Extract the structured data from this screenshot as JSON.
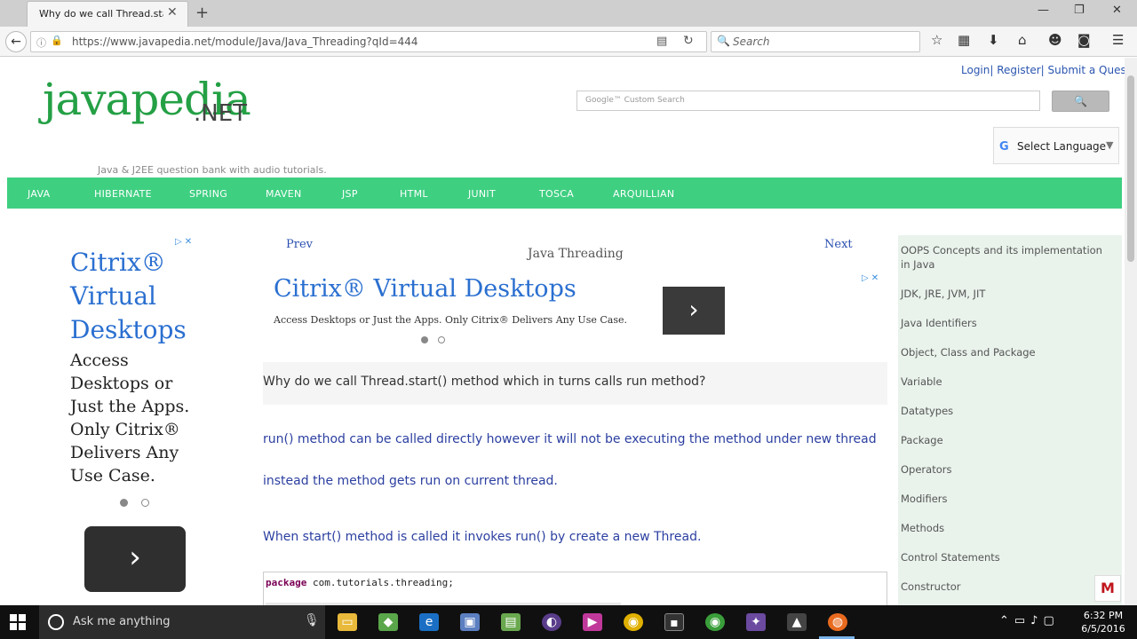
{
  "browser": {
    "tab_title": "Why do we call Thread.sta...",
    "tab_close": "✕",
    "new_tab": "+",
    "url": "https://www.javapedia.net/module/Java/Java_Threading?qId=444",
    "search_placeholder": "Search"
  },
  "site": {
    "top_links": "Login| Register| Submit a Question",
    "logo_text": "javapedia",
    "logo_suffix": ".NET",
    "tagline": "Java & J2EE question bank with audio tutorials.",
    "search_placeholder": "Google™ Custom Search",
    "search_button": "🔍",
    "language": "Select Language",
    "language_arrow": "▼",
    "nav": [
      "JAVA",
      "HIBERNATE",
      "SPRING",
      "MAVEN",
      "JSP",
      "HTML",
      "JUNIT",
      "TOSCA",
      "ARQUILLIAN"
    ]
  },
  "ad_left": {
    "badge": "▷✕",
    "title": "Citrix® Virtual Desktops",
    "body": "Access Desktops or Just the Apps. Only Citrix® Delivers Any Use Case.",
    "arrow": "›"
  },
  "content": {
    "prev": "Prev",
    "next": "Next",
    "heading": "Java Threading",
    "ad_badge": "▷✕",
    "ad_title": "Citrix® Virtual Desktops",
    "ad_body": "Access Desktops or Just the Apps. Only Citrix® Delivers Any Use Case.",
    "ad_arrow": "›",
    "question": "Why do we call Thread.start() method which in turns calls run method?",
    "answer_line1": "run() method can be called directly however it will not be executing the method under new thread",
    "answer_line2": "instead the method gets run on current thread.",
    "answer_line3": "When start() method is called it invokes run() by create a new Thread.",
    "code_keyword": "package",
    "code_rest": " com.tutorials.threading;"
  },
  "sidebar": {
    "items": [
      "OOPS Concepts and its implementation in Java",
      "JDK, JRE, JVM, JIT",
      "Java Identifiers",
      "Object, Class and Package",
      "Variable",
      "Datatypes",
      "Package",
      "Operators",
      "Modifiers",
      "Methods",
      "Control Statements",
      "Constructor"
    ],
    "badge": "M"
  },
  "taskbar": {
    "search_text": "Ask me anything",
    "time": "6:32 PM",
    "date": "6/5/2016"
  },
  "colors": {
    "nav_green": "#3fcf81",
    "link_blue": "#2b3fa0",
    "logo_green": "#24a045"
  }
}
